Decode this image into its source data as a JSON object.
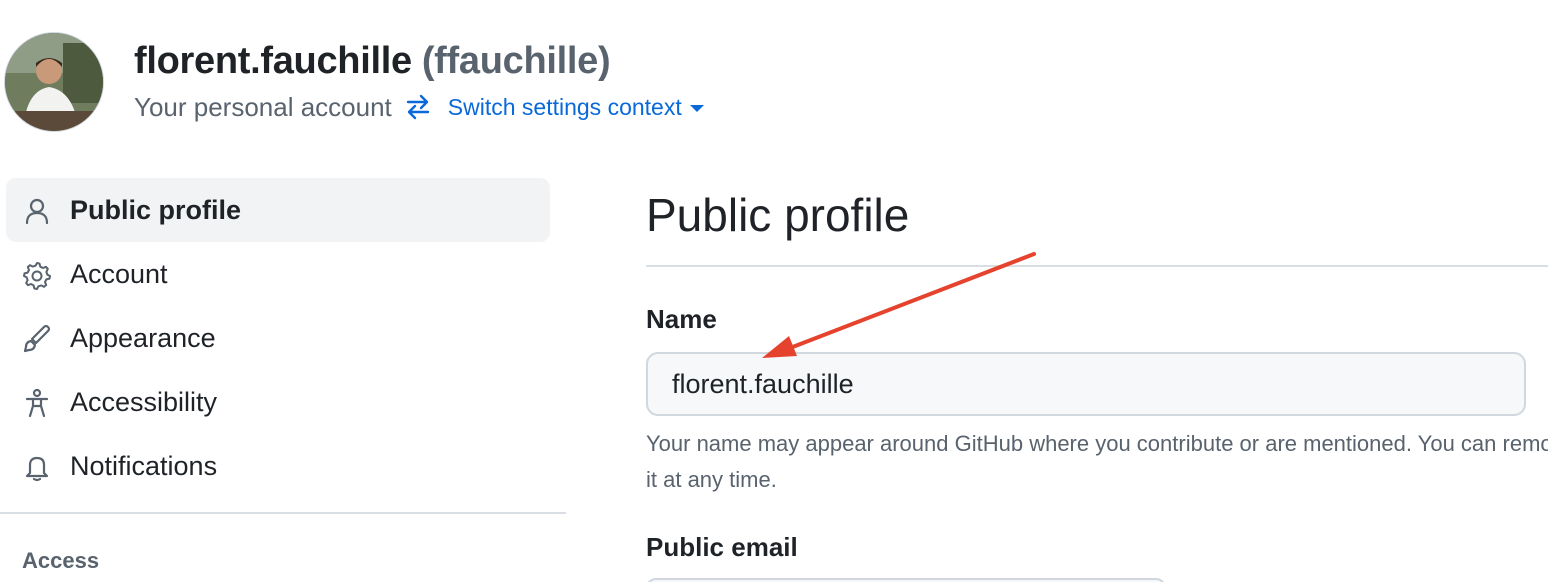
{
  "header": {
    "display_name": "florent.fauchille",
    "login": "(ffauchille)",
    "account_type": "Your personal account",
    "switch_context_label": "Switch settings context"
  },
  "sidebar": {
    "items": [
      {
        "label": "Public profile",
        "icon": "person-icon",
        "selected": true
      },
      {
        "label": "Account",
        "icon": "gear-icon",
        "selected": false
      },
      {
        "label": "Appearance",
        "icon": "paintbrush-icon",
        "selected": false
      },
      {
        "label": "Accessibility",
        "icon": "accessibility-icon",
        "selected": false
      },
      {
        "label": "Notifications",
        "icon": "bell-icon",
        "selected": false
      }
    ],
    "section_heading": "Access"
  },
  "main": {
    "title": "Public profile",
    "name_label": "Name",
    "name_value": "florent.fauchille",
    "name_hint": "Your name may appear around GitHub where you contribute or are mentioned. You can remove it at any time.",
    "email_label": "Public email"
  },
  "colors": {
    "link": "#0969da",
    "annotation_arrow": "#e5432d",
    "selected_bg": "#f1f3f5"
  }
}
